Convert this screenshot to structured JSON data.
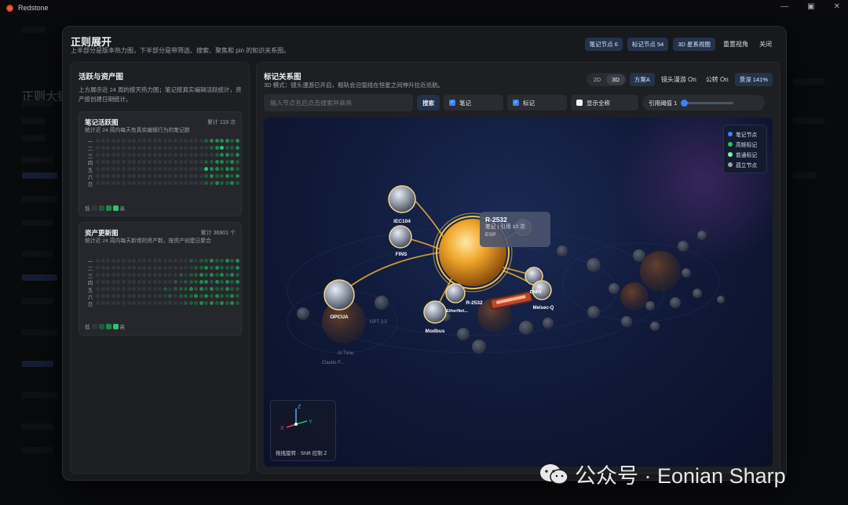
{
  "app": {
    "title": "Redstone"
  },
  "background": {
    "title": "正则大钟"
  },
  "modal": {
    "title": "正则展开",
    "subtitle": "上半部分是版本热力图，下半部分是带筛选、搜索、聚焦和 pin 的知识关系图。",
    "stats": {
      "note_nodes": "笔记节点 6",
      "tag_nodes": "标记节点 54"
    },
    "buttons": {
      "starmap": "3D 星系视图",
      "reset_view": "重置视角",
      "close": "关闭"
    }
  },
  "left_panel": {
    "title": "活跃与资产图",
    "desc": "上方展示近 24 周的按天热力图；笔记按真实编辑活跃统计，资产按创建日期统计。",
    "notes_card": {
      "title": "笔记活跃图",
      "count": "累计 119 次",
      "desc": "统计近 24 周内每天有真实编辑行为的笔记数",
      "days": [
        "一",
        "二",
        "三",
        "四",
        "五",
        "六",
        "日"
      ],
      "legend_low": "低",
      "legend_high": "高",
      "grid": [
        [
          0,
          0,
          0,
          0,
          0,
          0,
          0,
          0,
          0,
          0,
          0,
          0,
          0,
          0,
          0,
          0,
          0,
          0,
          0,
          0,
          0,
          1,
          2,
          2,
          2,
          2,
          1,
          2
        ],
        [
          0,
          0,
          0,
          0,
          0,
          0,
          0,
          0,
          0,
          0,
          0,
          0,
          0,
          0,
          0,
          0,
          0,
          0,
          0,
          0,
          0,
          0,
          1,
          2,
          3,
          1,
          1,
          2
        ],
        [
          0,
          0,
          0,
          0,
          0,
          0,
          0,
          0,
          0,
          0,
          0,
          0,
          0,
          0,
          0,
          0,
          0,
          0,
          0,
          0,
          0,
          0,
          0,
          1,
          2,
          2,
          1,
          2
        ],
        [
          0,
          0,
          0,
          0,
          0,
          0,
          0,
          0,
          0,
          0,
          0,
          0,
          0,
          0,
          0,
          0,
          0,
          0,
          0,
          0,
          0,
          1,
          1,
          2,
          2,
          1,
          2,
          1
        ],
        [
          0,
          0,
          0,
          0,
          0,
          0,
          0,
          0,
          0,
          0,
          0,
          0,
          0,
          0,
          0,
          0,
          0,
          0,
          0,
          0,
          0,
          3,
          2,
          2,
          1,
          2,
          2,
          1
        ],
        [
          0,
          0,
          0,
          0,
          0,
          0,
          0,
          0,
          0,
          0,
          0,
          0,
          0,
          0,
          0,
          0,
          0,
          0,
          0,
          0,
          0,
          1,
          2,
          1,
          1,
          2,
          1,
          2
        ],
        [
          0,
          0,
          0,
          0,
          0,
          0,
          0,
          0,
          0,
          0,
          0,
          0,
          0,
          0,
          0,
          0,
          0,
          0,
          0,
          0,
          0,
          1,
          1,
          2,
          1,
          1,
          2,
          1
        ]
      ]
    },
    "assets_card": {
      "title": "资产更新图",
      "count": "累计 36901 个",
      "desc": "统计近 24 周内每天新增的资产数，按资产创建日聚合",
      "days": [
        "一",
        "二",
        "三",
        "四",
        "五",
        "六",
        "日"
      ],
      "legend_low": "低",
      "legend_high": "高",
      "grid": [
        [
          0,
          0,
          0,
          0,
          0,
          0,
          0,
          0,
          0,
          0,
          0,
          0,
          0,
          0,
          0,
          0,
          0,
          0,
          1,
          0,
          1,
          1,
          2,
          1,
          1,
          2,
          1,
          2
        ],
        [
          0,
          0,
          0,
          0,
          0,
          0,
          0,
          0,
          0,
          0,
          0,
          0,
          0,
          0,
          0,
          0,
          0,
          0,
          0,
          1,
          1,
          2,
          1,
          2,
          1,
          1,
          1,
          2
        ],
        [
          0,
          0,
          0,
          0,
          0,
          0,
          0,
          0,
          0,
          0,
          0,
          0,
          0,
          0,
          0,
          0,
          1,
          0,
          1,
          1,
          2,
          1,
          2,
          1,
          2,
          1,
          2,
          1
        ],
        [
          0,
          0,
          0,
          0,
          0,
          0,
          0,
          0,
          0,
          0,
          0,
          0,
          0,
          0,
          0,
          1,
          0,
          1,
          1,
          1,
          2,
          2,
          1,
          2,
          1,
          2,
          1,
          2
        ],
        [
          0,
          0,
          0,
          0,
          0,
          0,
          0,
          0,
          0,
          0,
          0,
          0,
          0,
          1,
          0,
          1,
          1,
          1,
          2,
          1,
          2,
          1,
          2,
          1,
          1,
          2,
          1,
          1
        ],
        [
          0,
          0,
          0,
          0,
          0,
          0,
          0,
          0,
          0,
          0,
          0,
          0,
          0,
          0,
          1,
          0,
          1,
          1,
          1,
          2,
          1,
          2,
          1,
          2,
          1,
          1,
          2,
          1
        ],
        [
          0,
          0,
          0,
          0,
          0,
          0,
          0,
          0,
          0,
          0,
          0,
          0,
          0,
          0,
          0,
          0,
          0,
          1,
          1,
          1,
          2,
          1,
          2,
          1,
          2,
          1,
          2,
          1
        ]
      ]
    }
  },
  "right_panel": {
    "title": "标记关系图",
    "desc": "3D 模式：镜头漫游已开启，粗轨会沿弧线在恒星之间伸升拉近巡航。",
    "mode_2d": "2D",
    "mode_3d": "3D",
    "scheme": "方案A",
    "camera_roam": "镜头漫游 On",
    "rotation": "公转 On",
    "zoom": "景深 141%",
    "search_placeholder": "输入节点名后点击搜索并高亮",
    "search_button": "搜索",
    "filter_notes": "笔记",
    "filter_tags": "标记",
    "show_fullname": "显示全称",
    "threshold": "引用阈值 1",
    "legend": [
      {
        "label": "笔记节点",
        "color": "#3b82f6"
      },
      {
        "label": "高频标记",
        "color": "#22c55e"
      },
      {
        "label": "普通标记",
        "color": "#86efac"
      },
      {
        "label": "孤立节点",
        "color": "#9ca3af"
      }
    ],
    "tooltip": {
      "title": "R-2532",
      "line1": "笔记 | 引用 10 次",
      "line2": "ESP"
    },
    "axis_tip": "拖拽旋转 · Shift 控制 Z",
    "nodes": {
      "iec104": "IEC104",
      "fins": "FINS",
      "opcua": "OPCUA",
      "modbus": "Modbus",
      "ethernet": "EtherNet...",
      "r2532": "R-2532",
      "dnp3": "DNP3",
      "melsec": "Melsec-Q",
      "ai": "AI Time",
      "gpt": "GPT 3.5",
      "claude": "Claude F..."
    }
  },
  "watermark": "公众号 · Eonian Sharp"
}
